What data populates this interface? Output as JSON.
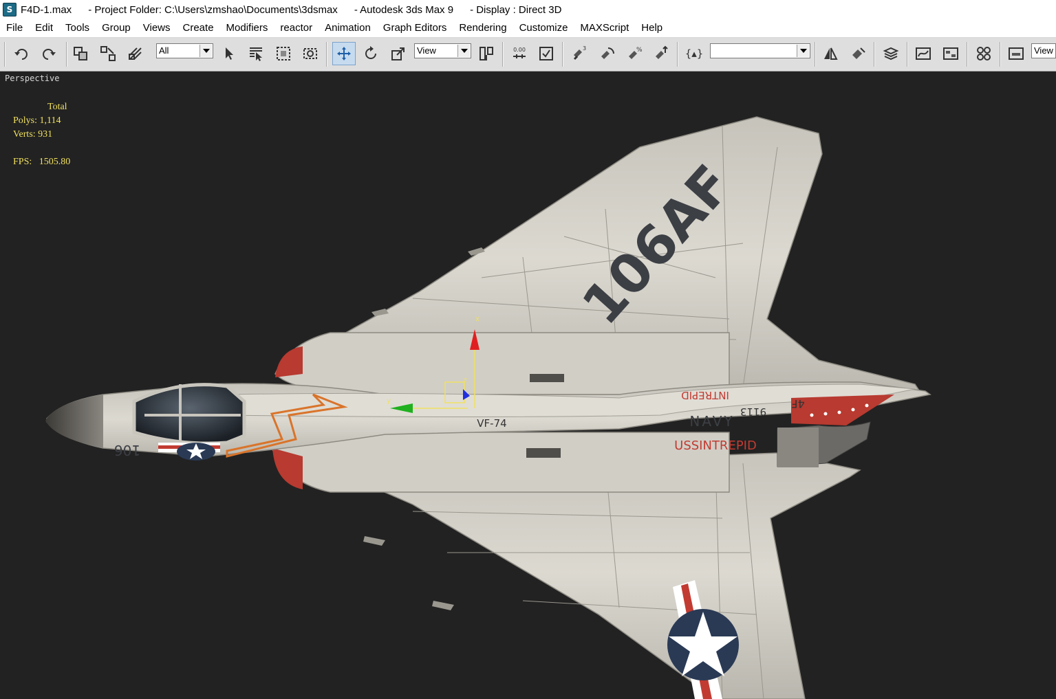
{
  "titlebar": {
    "file": "F4D-1.max",
    "project": "- Project Folder: C:\\Users\\zmshao\\Documents\\3dsmax",
    "app": "- Autodesk 3ds Max 9",
    "display": "- Display : Direct 3D"
  },
  "menu": [
    "File",
    "Edit",
    "Tools",
    "Group",
    "Views",
    "Create",
    "Modifiers",
    "reactor",
    "Animation",
    "Graph Editors",
    "Rendering",
    "Customize",
    "MAXScript",
    "Help"
  ],
  "toolbar": {
    "selection_filter": "All",
    "reference_coord": "View",
    "named_selection": "",
    "view_tab": "View",
    "spinner_snap": "0.00"
  },
  "viewport": {
    "label": "Perspective",
    "stats": {
      "header": "Total",
      "polys_label": "Polys:",
      "polys_value": "1,114",
      "verts_label": "Verts:",
      "verts_value": "931",
      "fps_label": "FPS:",
      "fps_value": "1505.80"
    },
    "model_markings": {
      "wing_code": "106AF",
      "squadron": "VF-74",
      "service": "NAVY",
      "ship": "USSINTREPID",
      "ship_mirrored": "INTREPID",
      "serial": "9113",
      "tail_code": "4F",
      "nose_code": "106"
    },
    "gizmo": {
      "x": "x",
      "y": "y",
      "z": "z"
    },
    "colors": {
      "background": "#222222",
      "stats_text": "#f0e060",
      "gizmo_x": "#e02020",
      "gizmo_y": "#20b020",
      "gizmo_z": "#2030e0"
    }
  }
}
